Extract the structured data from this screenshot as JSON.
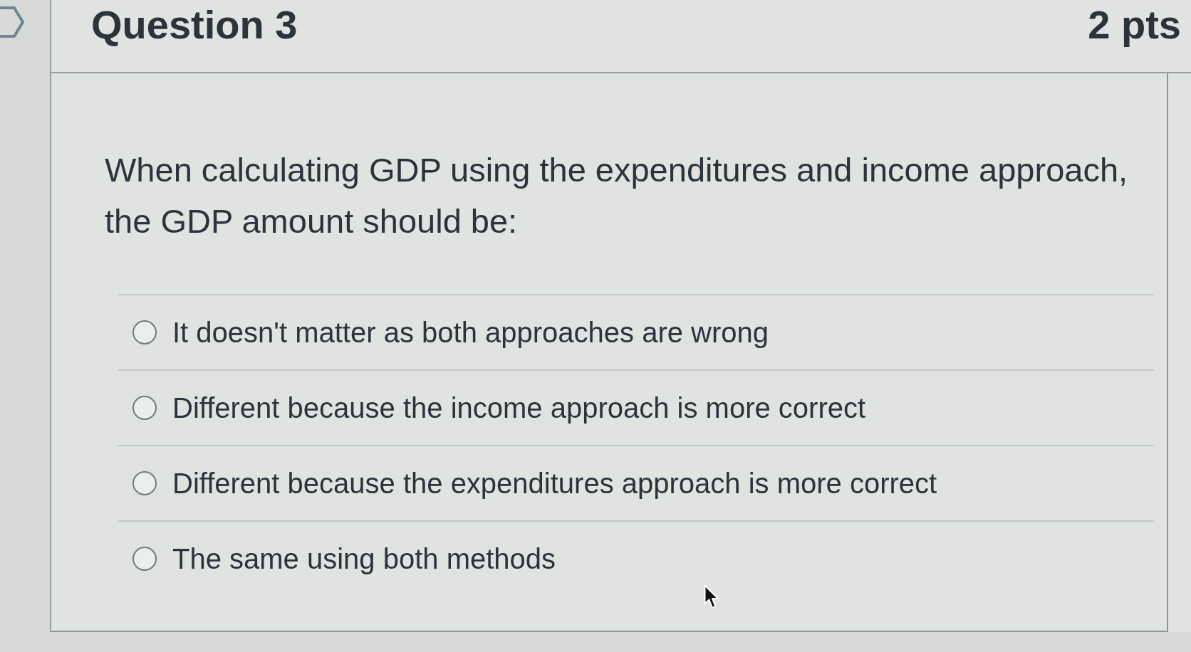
{
  "question": {
    "title": "Question 3",
    "points": "2 pts",
    "text": "When calculating GDP using the expenditures and income approach, the GDP amount should be:"
  },
  "answers": [
    {
      "label": "It doesn't matter as both approaches are wrong",
      "selected": false
    },
    {
      "label": "Different because the income approach is more correct",
      "selected": false
    },
    {
      "label": "Different because the expenditures approach is more correct",
      "selected": false
    },
    {
      "label": "The same using both methods",
      "selected": false
    }
  ]
}
